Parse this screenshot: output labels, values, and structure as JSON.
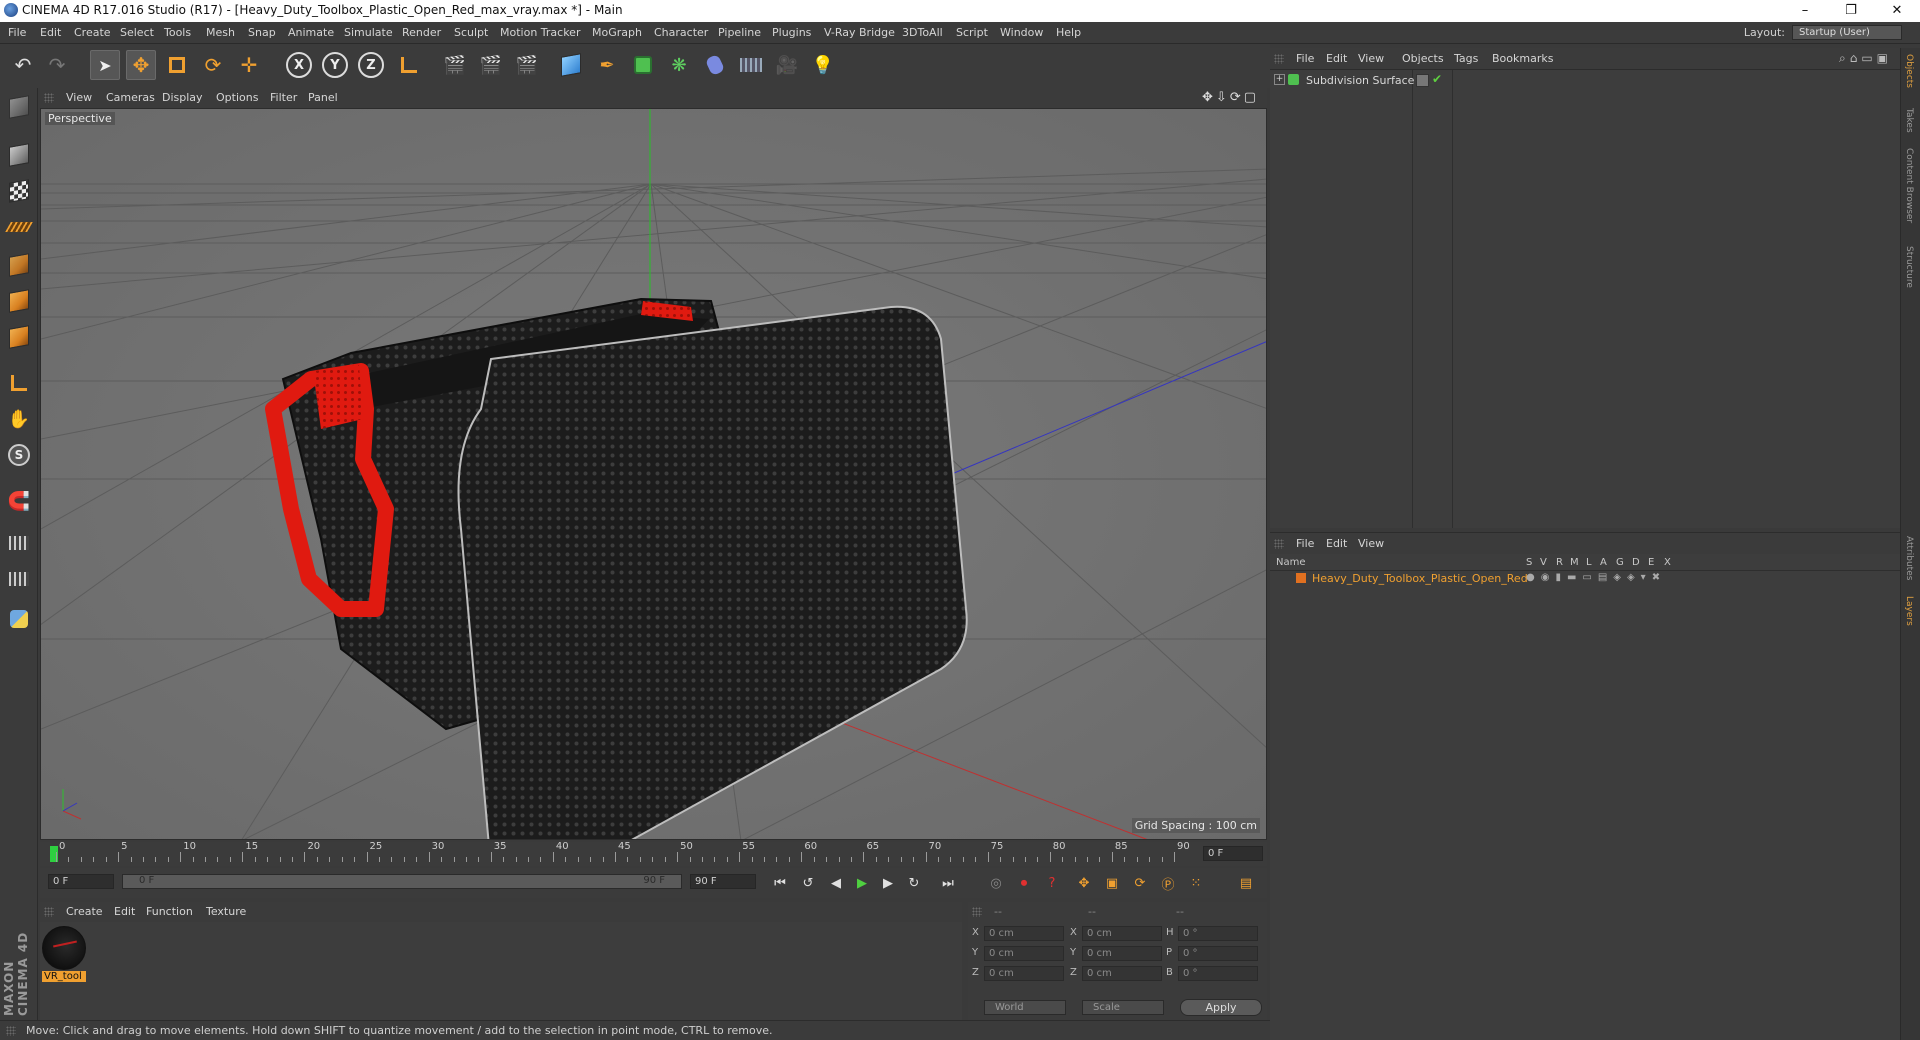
{
  "window": {
    "title": "CINEMA 4D R17.016 Studio (R17) - [Heavy_Duty_Toolbox_Plastic_Open_Red_max_vray.max *] - Main",
    "minimize": "–",
    "restore": "❐",
    "close": "✕"
  },
  "menubar": {
    "items": [
      "File",
      "Edit",
      "Create",
      "Select",
      "Tools",
      "Mesh",
      "Snap",
      "Animate",
      "Simulate",
      "Render",
      "Sculpt",
      "Motion Tracker",
      "MoGraph",
      "Character",
      "Pipeline",
      "Plugins",
      "V-Ray Bridge",
      "3DToAll",
      "Script",
      "Window",
      "Help"
    ],
    "layout_label": "Layout:",
    "layout_value": "Startup (User)"
  },
  "toolbar": {
    "axis_x": "X",
    "axis_y": "Y",
    "axis_z": "Z"
  },
  "viewport": {
    "menu": [
      "View",
      "Cameras",
      "Display",
      "Options",
      "Filter",
      "Panel"
    ],
    "label": "Perspective",
    "grid_spacing": "Grid Spacing : 100 cm"
  },
  "timeline": {
    "ticks": [
      "0",
      "5",
      "10",
      "15",
      "20",
      "25",
      "30",
      "35",
      "40",
      "45",
      "50",
      "55",
      "60",
      "65",
      "70",
      "75",
      "80",
      "85",
      "90"
    ],
    "current_frame": "0 F",
    "start_field": "0 F",
    "range_start": "0 F",
    "range_end": "90 F",
    "end_field": "90 F"
  },
  "material_manager": {
    "menu": [
      "Create",
      "Edit",
      "Function",
      "Texture"
    ],
    "material_name": "VR_tool"
  },
  "coordinates": {
    "header": [
      "--",
      "--",
      "--"
    ],
    "rows": [
      {
        "axis1": "X",
        "val1": "0 cm",
        "axis2": "X",
        "val2": "0 cm",
        "axis3": "H",
        "val3": "0 °"
      },
      {
        "axis1": "Y",
        "val1": "0 cm",
        "axis2": "Y",
        "val2": "0 cm",
        "axis3": "P",
        "val3": "0 °"
      },
      {
        "axis1": "Z",
        "val1": "0 cm",
        "axis2": "Z",
        "val2": "0 cm",
        "axis3": "B",
        "val3": "0 °"
      }
    ],
    "mode_world": "World",
    "mode_scale": "Scale",
    "apply": "Apply"
  },
  "object_manager": {
    "menu": [
      "File",
      "Edit",
      "View",
      "Objects",
      "Tags",
      "Bookmarks"
    ],
    "object": "Subdivision Surface"
  },
  "layer_manager": {
    "menu": [
      "File",
      "Edit",
      "View"
    ],
    "columns": [
      "Name",
      "S",
      "V",
      "R",
      "M",
      "L",
      "A",
      "G",
      "D",
      "E",
      "X"
    ],
    "layer": "Heavy_Duty_Toolbox_Plastic_Open_Red"
  },
  "right_tabs": [
    "Objects",
    "Takes",
    "Content Browser",
    "Structure",
    "Attributes",
    "Layers"
  ],
  "brand": "MAXON CINEMA 4D",
  "status": "Move: Click and drag to move elements. Hold down SHIFT to quantize movement / add to the selection in point mode, CTRL to remove.",
  "colors": {
    "accent_orange": "#f09a2a",
    "layer_text": "#f0a030",
    "play_green": "#4fd040",
    "record_red": "#e03030"
  }
}
